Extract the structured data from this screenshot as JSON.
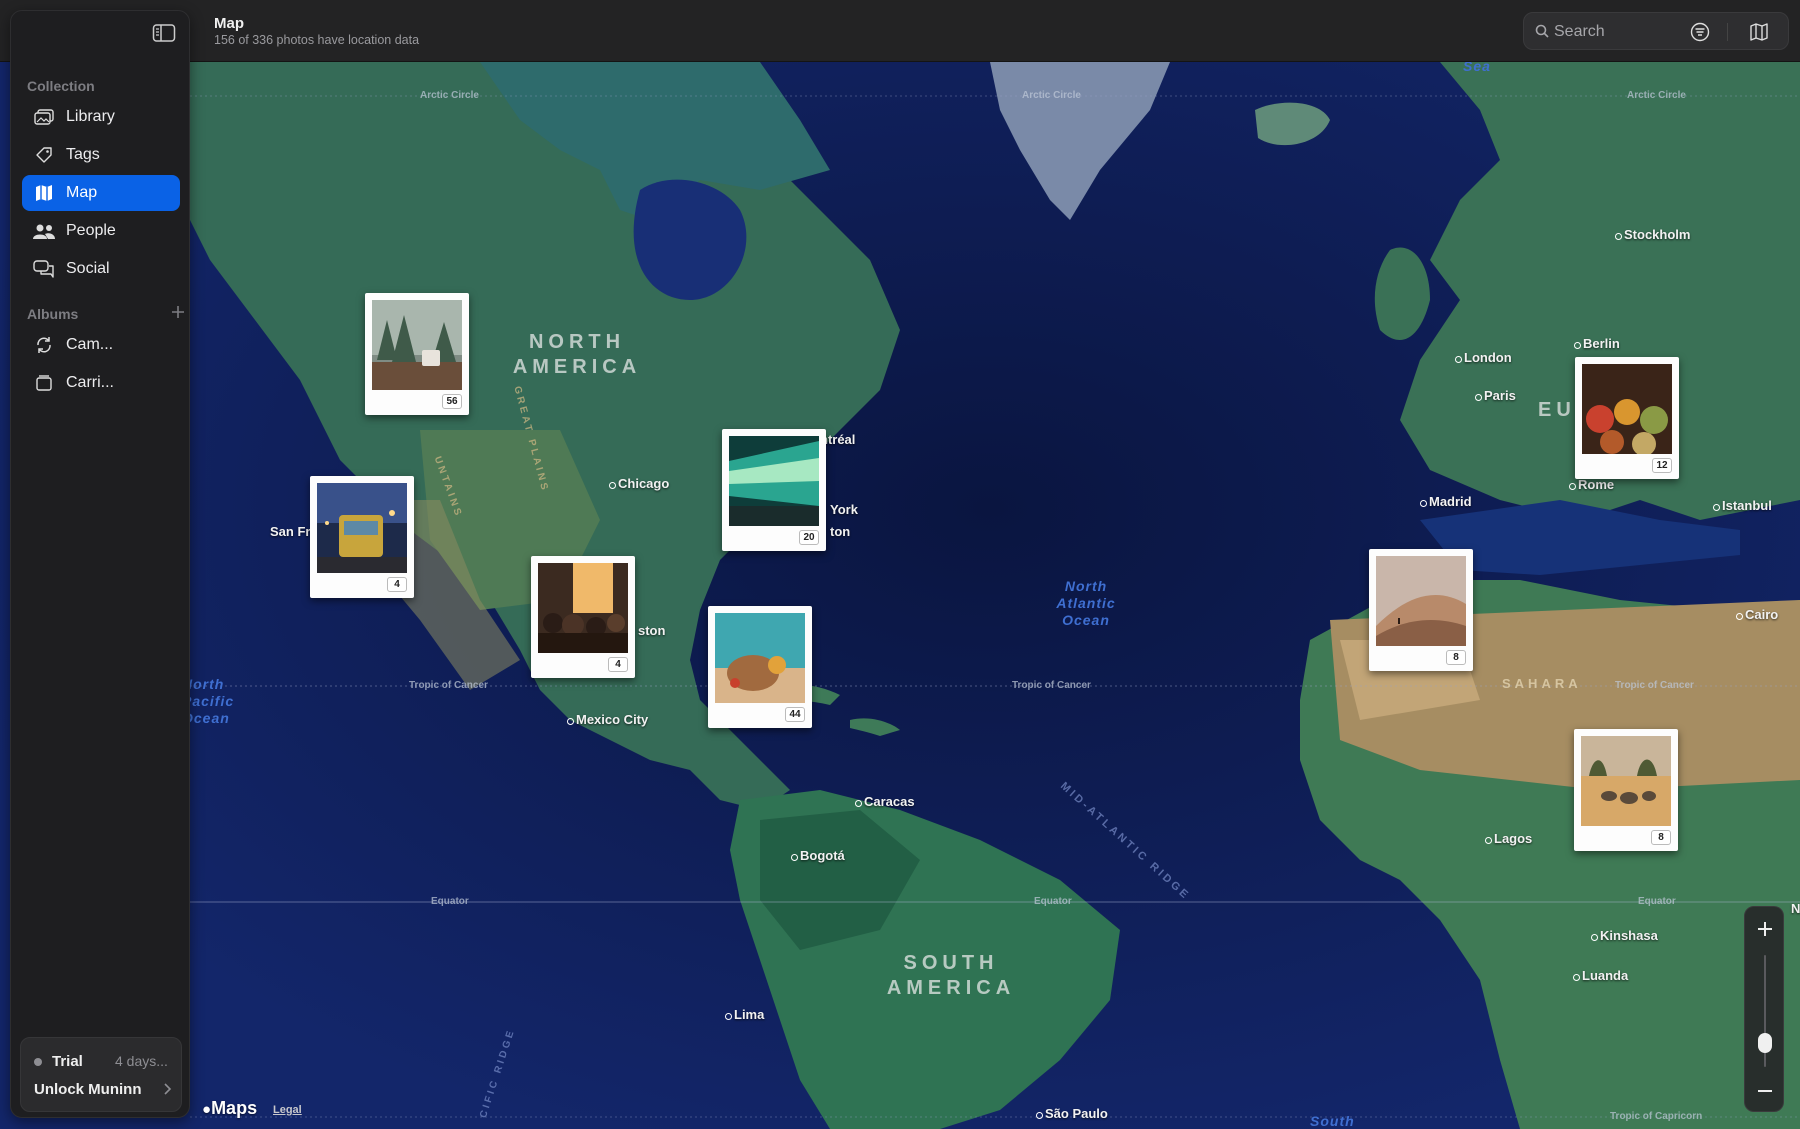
{
  "header": {
    "title": "Map",
    "subtitle": "156 of 336 photos have location data"
  },
  "search": {
    "placeholder": "Search",
    "value": ""
  },
  "toolbar": {
    "filter_icon": "filter-lines-icon",
    "map_style_icon": "folded-map-icon"
  },
  "sidebar": {
    "collection_heading": "Collection",
    "items": [
      {
        "label": "Library",
        "icon": "photo-stack-icon"
      },
      {
        "label": "Tags",
        "icon": "tag-icon"
      },
      {
        "label": "Map",
        "icon": "folded-map-icon",
        "active": true
      },
      {
        "label": "People",
        "icon": "people-icon"
      },
      {
        "label": "Social",
        "icon": "speech-bubbles-icon"
      }
    ],
    "albums_heading": "Albums",
    "albums": [
      {
        "label": "Cam...",
        "icon": "sync-icon"
      },
      {
        "label": "Carri...",
        "icon": "folder-icon"
      }
    ],
    "trial": {
      "label": "Trial",
      "remaining": "4 days...",
      "cta": "Unlock Muninn"
    }
  },
  "map": {
    "continents": {
      "north_america": "NORTH\nAMERICA",
      "south_america": "SOUTH\nAMERICA",
      "europe_partial": "EU",
      "sahara": "SAHARA"
    },
    "oceans": {
      "north_atlantic": "North\nAtlantic\nOcean",
      "north_pacific": "North\nPacific\nOcean",
      "sea_top": "Sea",
      "south_bottom": "South"
    },
    "geo_lines": {
      "arctic_circle": "Arctic Circle",
      "tropic_of_cancer": "Tropic of Cancer",
      "equator": "Equator",
      "tropic_of_capricorn": "Tropic of Capricorn"
    },
    "features": {
      "rocky_mountains_partial": "UNTAINS",
      "great_plains": "GREAT PLAINS",
      "mid_atlantic_ridge": "MID-ATLANTIC RIDGE",
      "pacific_ridge_partial": "CIFIC RIDGE"
    },
    "cities": {
      "stockholm": "Stockholm",
      "berlin": "Berlin",
      "london": "London",
      "paris": "Paris",
      "madrid": "Madrid",
      "rome": "Rome",
      "istanbul": "Istanbul",
      "cairo": "Cairo",
      "lagos": "Lagos",
      "kinshasa": "Kinshasa",
      "luanda": "Luanda",
      "chicago": "Chicago",
      "montreal_partial": "ntréal",
      "new_york_partial": "York",
      "boston_partial": "ton",
      "san_francisco_partial": "San Fr",
      "houston_partial": "ston",
      "mexico_city": "Mexico City",
      "caracas": "Caracas",
      "bogota": "Bogotá",
      "lima": "Lima",
      "sao_paulo": "São Paulo",
      "n_partial": "N"
    },
    "pins": [
      {
        "id": "canada-west",
        "count": "56",
        "subject": "coffee mug in misty forest"
      },
      {
        "id": "san-francisco",
        "count": "4",
        "subject": "cable car at dusk"
      },
      {
        "id": "texas",
        "count": "4",
        "subject": "crowded market at sunset"
      },
      {
        "id": "new-york",
        "count": "20",
        "subject": "subway train motion blur"
      },
      {
        "id": "caribbean",
        "count": "44",
        "subject": "tropical picnic on sand"
      },
      {
        "id": "morocco",
        "count": "8",
        "subject": "desert dunes"
      },
      {
        "id": "turkey",
        "count": "12",
        "subject": "spice market"
      },
      {
        "id": "west-africa",
        "count": "8",
        "subject": "elephants on savanna"
      }
    ],
    "branding": {
      "maps": "Maps",
      "legal": "Legal"
    },
    "zoom": {
      "in_label": "+",
      "out_label": "−",
      "level": 0.15
    }
  }
}
